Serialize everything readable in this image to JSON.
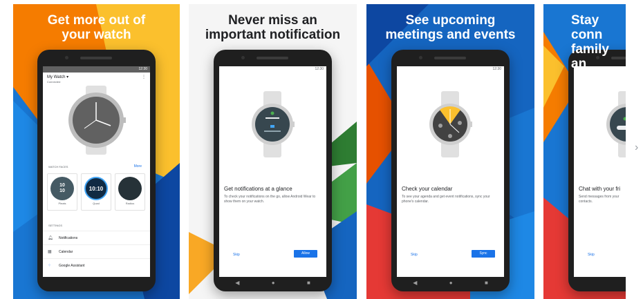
{
  "cards": [
    {
      "headline": "Get more out of\nyour watch",
      "screen": {
        "time": "12:30",
        "device_title": "My Watch",
        "device_status": "Connected",
        "watch_faces_label": "WATCH FACES",
        "more_label": "More",
        "faces": [
          {
            "name": "Pleats",
            "time": "10\n10"
          },
          {
            "name": "Quad",
            "time": "10:10"
          },
          {
            "name": "Radius",
            "time": ""
          }
        ],
        "settings_label": "SETTINGS",
        "settings_items": [
          "Notifications",
          "Calendar",
          "Google Assistant"
        ]
      }
    },
    {
      "headline": "Never miss an\nimportant notification",
      "screen": {
        "time": "12:30",
        "title": "Get notifications at a glance",
        "body": "To check your notifications on the go, allow Android Wear to show them on your watch.",
        "skip_label": "Skip",
        "action_label": "Allow"
      }
    },
    {
      "headline": "See upcoming\nmeetings and events",
      "screen": {
        "time": "12:30",
        "title": "Check your calendar",
        "body": "To see your agenda and get event notifications, sync your phone's calendar.",
        "skip_label": "Skip",
        "action_label": "Sync"
      }
    },
    {
      "headline": "Stay conn\nfamily an",
      "screen": {
        "title": "Chat with your fri",
        "body": "Send messages from your\ncontacts.",
        "skip_label": "Skip"
      }
    }
  ],
  "nav": {
    "back": "◀",
    "home": "●",
    "recents": "■"
  },
  "next_arrow": "›",
  "colors": {
    "blue": "#1565c0",
    "yellow": "#f9a825",
    "orange": "#ef6c00",
    "red": "#e53935",
    "green": "#2e7d32",
    "link": "#1a73e8"
  }
}
